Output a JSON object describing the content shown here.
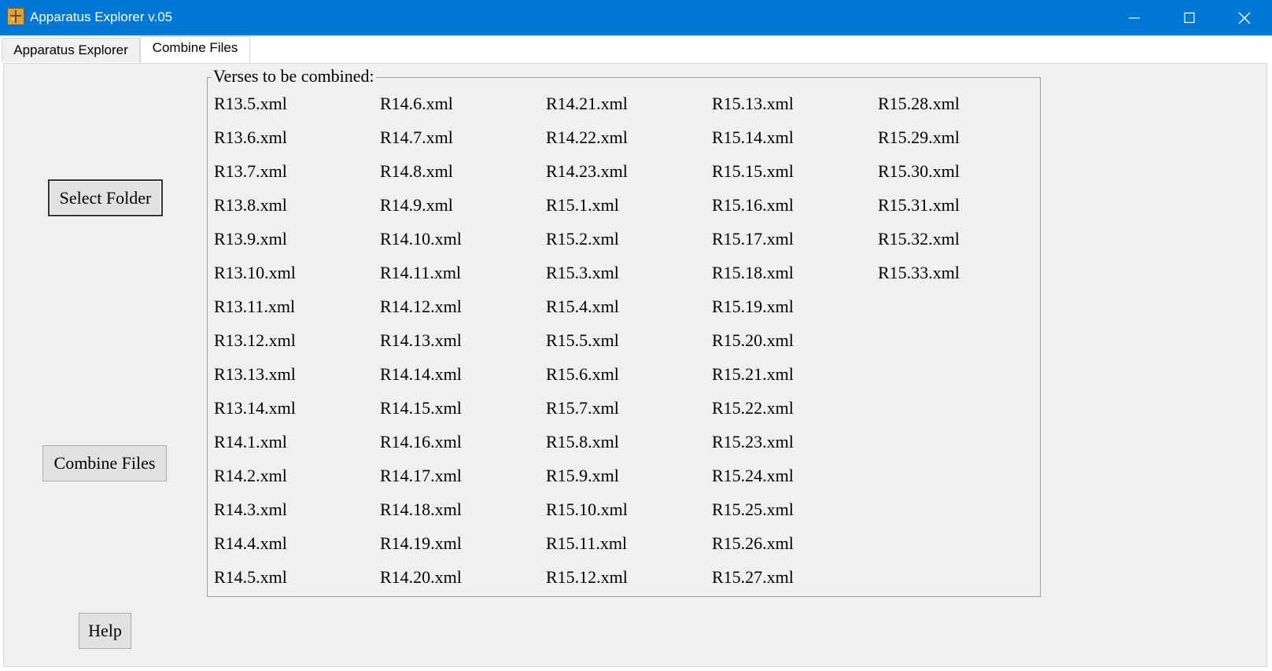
{
  "window": {
    "title": "Apparatus Explorer v.05"
  },
  "tabs": [
    {
      "label": "Apparatus Explorer"
    },
    {
      "label": "Combine Files"
    }
  ],
  "buttons": {
    "select_folder": "Select Folder",
    "combine_files": "Combine Files",
    "help": "Help"
  },
  "groupbox": {
    "title": "Verses to be combined:"
  },
  "files": [
    "R13.5.xml",
    "R13.6.xml",
    "R13.7.xml",
    "R13.8.xml",
    "R13.9.xml",
    "R13.10.xml",
    "R13.11.xml",
    "R13.12.xml",
    "R13.13.xml",
    "R13.14.xml",
    "R14.1.xml",
    "R14.2.xml",
    "R14.3.xml",
    "R14.4.xml",
    "R14.5.xml",
    "R14.6.xml",
    "R14.7.xml",
    "R14.8.xml",
    "R14.9.xml",
    "R14.10.xml",
    "R14.11.xml",
    "R14.12.xml",
    "R14.13.xml",
    "R14.14.xml",
    "R14.15.xml",
    "R14.16.xml",
    "R14.17.xml",
    "R14.18.xml",
    "R14.19.xml",
    "R14.20.xml",
    "R14.21.xml",
    "R14.22.xml",
    "R14.23.xml",
    "R15.1.xml",
    "R15.2.xml",
    "R15.3.xml",
    "R15.4.xml",
    "R15.5.xml",
    "R15.6.xml",
    "R15.7.xml",
    "R15.8.xml",
    "R15.9.xml",
    "R15.10.xml",
    "R15.11.xml",
    "R15.12.xml",
    "R15.13.xml",
    "R15.14.xml",
    "R15.15.xml",
    "R15.16.xml",
    "R15.17.xml",
    "R15.18.xml",
    "R15.19.xml",
    "R15.20.xml",
    "R15.21.xml",
    "R15.22.xml",
    "R15.23.xml",
    "R15.24.xml",
    "R15.25.xml",
    "R15.26.xml",
    "R15.27.xml",
    "R15.28.xml",
    "R15.29.xml",
    "R15.30.xml",
    "R15.31.xml",
    "R15.32.xml",
    "R15.33.xml"
  ]
}
